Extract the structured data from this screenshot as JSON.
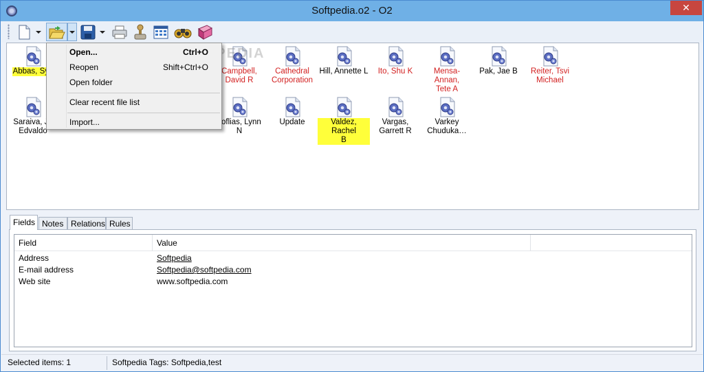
{
  "window": {
    "title": "Softpedia.o2 - O2",
    "close_glyph": "✕"
  },
  "toolbar": {
    "buttons": [
      {
        "icon": "new-document-icon",
        "dropdown": true
      },
      {
        "icon": "open-folder-icon",
        "dropdown": true,
        "pressed": true
      },
      {
        "icon": "save-disk-icon",
        "dropdown": true
      },
      {
        "icon": "printer-icon"
      },
      {
        "icon": "joystick-icon"
      },
      {
        "icon": "calendar-grid-icon"
      },
      {
        "icon": "binoculars-icon"
      },
      {
        "icon": "address-book-icon"
      }
    ]
  },
  "files": [
    {
      "label1": "Abbas, Sye",
      "label2": "",
      "red": false,
      "highlight": true
    },
    {
      "label1": "Campbell,",
      "label2": "David R",
      "red": true,
      "highlight": false
    },
    {
      "label1": "Cathedral",
      "label2": "Corporation",
      "red": true,
      "highlight": false
    },
    {
      "label1": "Hill, Annette L",
      "label2": "",
      "red": false,
      "highlight": false
    },
    {
      "label1": "Ito, Shu K",
      "label2": "",
      "red": true,
      "highlight": false
    },
    {
      "label1": "Mensa-Annan,",
      "label2": "Tete A",
      "red": true,
      "highlight": false
    },
    {
      "label1": "Pak, Jae B",
      "label2": "",
      "red": false,
      "highlight": false
    },
    {
      "label1": "Reiter, Tsvi",
      "label2": "Michael",
      "red": true,
      "highlight": false
    },
    {
      "label1": "Saraiva, Jo",
      "label2": "Edvaldo",
      "red": false,
      "highlight": false
    },
    {
      "label1": "soflias, Lynn",
      "label2": "N",
      "red": false,
      "highlight": false
    },
    {
      "label1": "Update",
      "label2": "",
      "red": false,
      "highlight": false
    },
    {
      "label1": "Valdez, Rachel",
      "label2": "B",
      "red": false,
      "highlight": true
    },
    {
      "label1": "Vargas,",
      "label2": "Garrett R",
      "red": false,
      "highlight": false
    },
    {
      "label1": "Varkey",
      "label2": "Chuduka…",
      "red": false,
      "highlight": false
    }
  ],
  "menu": {
    "items": [
      {
        "label": "Open...",
        "shortcut": "Ctrl+O",
        "bold": true
      },
      {
        "label": "Reopen",
        "shortcut": "Shift+Ctrl+O",
        "bold": false
      },
      {
        "label": "Open folder",
        "shortcut": "",
        "bold": false
      },
      {
        "label": "Clear recent file list",
        "shortcut": "",
        "bold": false
      },
      {
        "label": "Import...",
        "shortcut": "",
        "bold": false
      }
    ]
  },
  "watermark": "SOFTPEDIA",
  "tabs": [
    "Fields",
    "Notes",
    "Relations",
    "Rules"
  ],
  "grid": {
    "headers": [
      "Field",
      "Value"
    ],
    "rows": [
      {
        "field": "Address",
        "value": "Softpedia",
        "link": true
      },
      {
        "field": "E-mail address",
        "value": "Softpedia@softpedia.com",
        "link": true
      },
      {
        "field": "Web site",
        "value": "www.softpedia.com",
        "link": false
      }
    ]
  },
  "status": {
    "selected": "Selected items: 1",
    "tags": "Softpedia Tags: Softpedia,test"
  },
  "colors": {
    "title_bar": "#6fb0e6",
    "red_label": "#d21f1f",
    "highlight": "#ffff3a"
  }
}
